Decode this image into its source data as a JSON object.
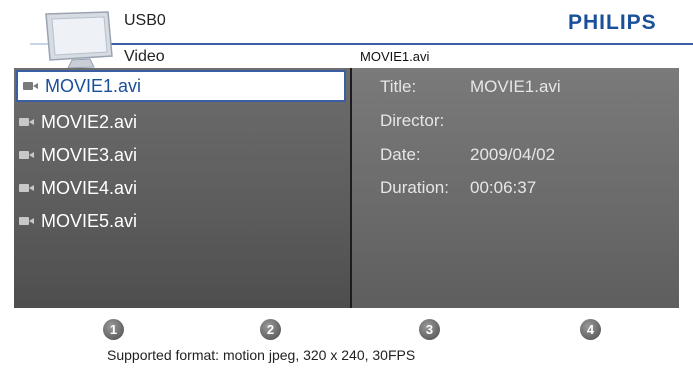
{
  "header": {
    "source": "USB0",
    "category": "Video",
    "current_file": "MOVIE1.avi",
    "brand": "PHILIPS",
    "brand_color": "#1a4f9a"
  },
  "files": [
    {
      "name": "MOVIE1.avi",
      "selected": true,
      "icon": "video-camera-icon"
    },
    {
      "name": "MOVIE2.avi",
      "selected": false,
      "icon": "video-camera-icon"
    },
    {
      "name": "MOVIE3.avi",
      "selected": false,
      "icon": "video-camera-icon"
    },
    {
      "name": "MOVIE4.avi",
      "selected": false,
      "icon": "video-camera-icon"
    },
    {
      "name": "MOVIE5.avi",
      "selected": false,
      "icon": "video-camera-icon"
    }
  ],
  "info": [
    {
      "key": "Title:",
      "value": "MOVIE1.avi"
    },
    {
      "key": "Director:",
      "value": ""
    },
    {
      "key": "Date:",
      "value": "2009/04/02"
    },
    {
      "key": "Duration:",
      "value": "00:06:37"
    }
  ],
  "buttons": [
    "1",
    "2",
    "3",
    "4"
  ],
  "footer": {
    "support": "Supported format: motion jpeg, 320 x 240, 30FPS"
  }
}
